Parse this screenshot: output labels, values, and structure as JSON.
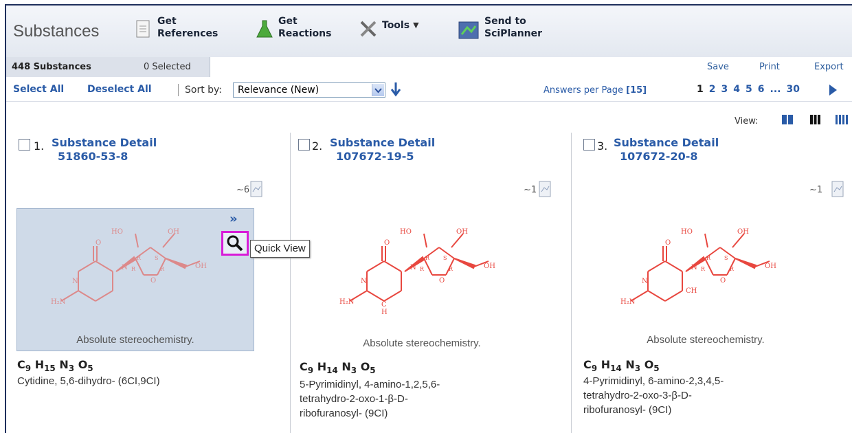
{
  "toolbar": {
    "title": "Substances",
    "get_references": "Get\nReferences",
    "get_reactions": "Get\nReactions",
    "tools": "Tools",
    "send_to": "Send to\nSciPlanner"
  },
  "infobar": {
    "count": "448 Substances",
    "selected": "0 Selected",
    "save": "Save",
    "print": "Print",
    "export": "Export"
  },
  "sortbar": {
    "select_all": "Select All",
    "deselect_all": "Deselect All",
    "sort_by": "Sort by:",
    "sort_value": "Relevance (New)",
    "answers_per_page": "Answers per Page",
    "answers_value": "[15]",
    "pages": [
      "1",
      "2",
      "3",
      "4",
      "5",
      "6",
      "...",
      "30"
    ]
  },
  "view": {
    "label": "View:"
  },
  "results": [
    {
      "num": "1.",
      "title": "Substance Detail",
      "cas": "51860-53-8",
      "refs": "~6",
      "stereo": "Absolute stereochemistry.",
      "formula": {
        "c": "C",
        "cn": "9",
        "h": "H",
        "hn": "15",
        "n": "N",
        "nn": "3",
        "o": "O",
        "on": "5"
      },
      "name_lines": [
        "Cytidine, 5,6-dihydro- (6CI,9CI)"
      ]
    },
    {
      "num": "2.",
      "title": "Substance Detail",
      "cas": "107672-19-5",
      "refs": "~1",
      "stereo": "Absolute stereochemistry.",
      "formula": {
        "c": "C",
        "cn": "9",
        "h": "H",
        "hn": "14",
        "n": "N",
        "nn": "3",
        "o": "O",
        "on": "5"
      },
      "name_lines": [
        "5-Pyrimidinyl, 4-amino-1,2,5,6-",
        "tetrahydro-2-oxo-1-β-D-",
        "ribofuranosyl- (9CI)"
      ]
    },
    {
      "num": "3.",
      "title": "Substance Detail",
      "cas": "107672-20-8",
      "refs": "~1",
      "stereo": "Absolute stereochemistry.",
      "formula": {
        "c": "C",
        "cn": "9",
        "h": "H",
        "hn": "14",
        "n": "N",
        "nn": "3",
        "o": "O",
        "on": "5"
      },
      "name_lines": [
        "4-Pyrimidinyl, 6-amino-2,3,4,5-",
        "tetrahydro-2-oxo-3-β-D-",
        "ribofuranosyl- (9CI)"
      ]
    }
  ],
  "quick_view": {
    "expand": "»",
    "tooltip": "Quick View"
  },
  "struct_labels": {
    "ho": "HO",
    "oh": "OH",
    "o": "O",
    "n": "N",
    "h2n": "H₂N",
    "r": "R",
    "s": "S",
    "ch": "CH",
    "c": "C",
    "h": "H"
  },
  "colors": {
    "structure": "#e8473f",
    "link": "#2a5ba7",
    "highlight": "#d81bd8"
  }
}
